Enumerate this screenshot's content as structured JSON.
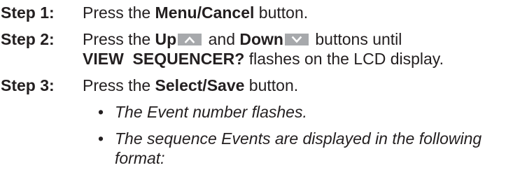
{
  "steps": [
    {
      "label": "Step 1:",
      "parts": {
        "pre": "Press the ",
        "bold": "Menu/Cancel",
        "post": " button."
      }
    },
    {
      "label": "Step 2:",
      "line1": {
        "pre": "Press the ",
        "up": "Up",
        "and": " and ",
        "down": "Down",
        "post": " buttons until"
      },
      "line2": {
        "bold": "VIEW  SEQUENCER?",
        "post": " flashes on the LCD display."
      }
    },
    {
      "label": "Step 3:",
      "parts": {
        "pre": "Press the ",
        "bold": "Select/Save",
        "post": " button."
      }
    }
  ],
  "bullets": [
    {
      "text": "The Event number flashes."
    },
    {
      "line1": "The sequence Events are displayed in the following",
      "line2": "format:"
    }
  ],
  "icons": {
    "up": "up-arrow-icon",
    "down": "down-arrow-icon",
    "key_color": "#a7a9ac",
    "glyph_color": "#ffffff"
  }
}
